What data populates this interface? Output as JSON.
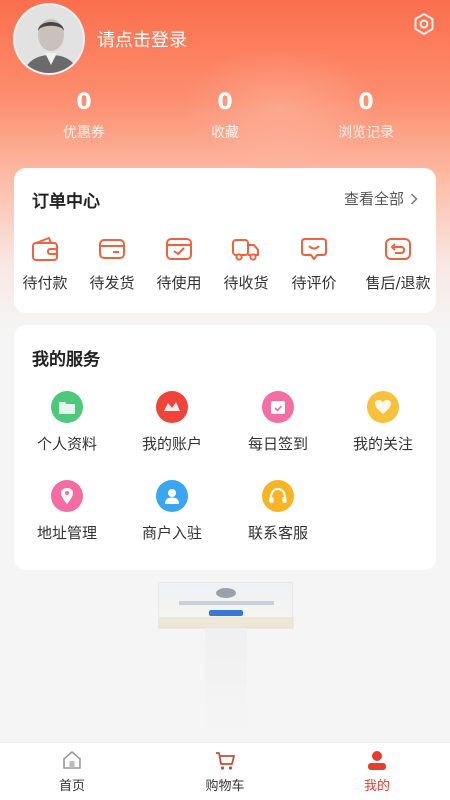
{
  "header": {
    "login_prompt": "请点击登录"
  },
  "stats": [
    {
      "value": "0",
      "label": "优惠券"
    },
    {
      "value": "0",
      "label": "收藏"
    },
    {
      "value": "0",
      "label": "浏览记录"
    }
  ],
  "orders": {
    "title": "订单中心",
    "view_all": "查看全部",
    "items": [
      {
        "label": "待付款",
        "icon": "wallet-icon"
      },
      {
        "label": "待发货",
        "icon": "card-icon"
      },
      {
        "label": "待使用",
        "icon": "check-box-icon"
      },
      {
        "label": "待收货",
        "icon": "truck-icon"
      },
      {
        "label": "待评价",
        "icon": "comment-icon"
      },
      {
        "label": "售后/退款",
        "icon": "return-icon"
      }
    ]
  },
  "services": {
    "title": "我的服务",
    "items": [
      {
        "label": "个人资料",
        "icon": "folder-icon",
        "color": "#4cc97a"
      },
      {
        "label": "我的账户",
        "icon": "account-icon",
        "color": "#f0443a"
      },
      {
        "label": "每日签到",
        "icon": "calendar-icon",
        "color": "#f36fa3"
      },
      {
        "label": "我的关注",
        "icon": "heart-icon",
        "color": "#f7c13b"
      },
      {
        "label": "地址管理",
        "icon": "location-icon",
        "color": "#f56ca2"
      },
      {
        "label": "商户入驻",
        "icon": "merchant-icon",
        "color": "#3aa6f2"
      },
      {
        "label": "联系客服",
        "icon": "headset-icon",
        "color": "#f7b526"
      }
    ]
  },
  "tabbar": {
    "items": [
      {
        "label": "首页",
        "icon": "home-icon"
      },
      {
        "label": "购物车",
        "icon": "cart-icon"
      },
      {
        "label": "我的",
        "icon": "user-icon"
      }
    ],
    "active_color": "#e63d2e"
  },
  "colors": {
    "accent": "#f0623e",
    "header_top": "#fb6f4d"
  }
}
